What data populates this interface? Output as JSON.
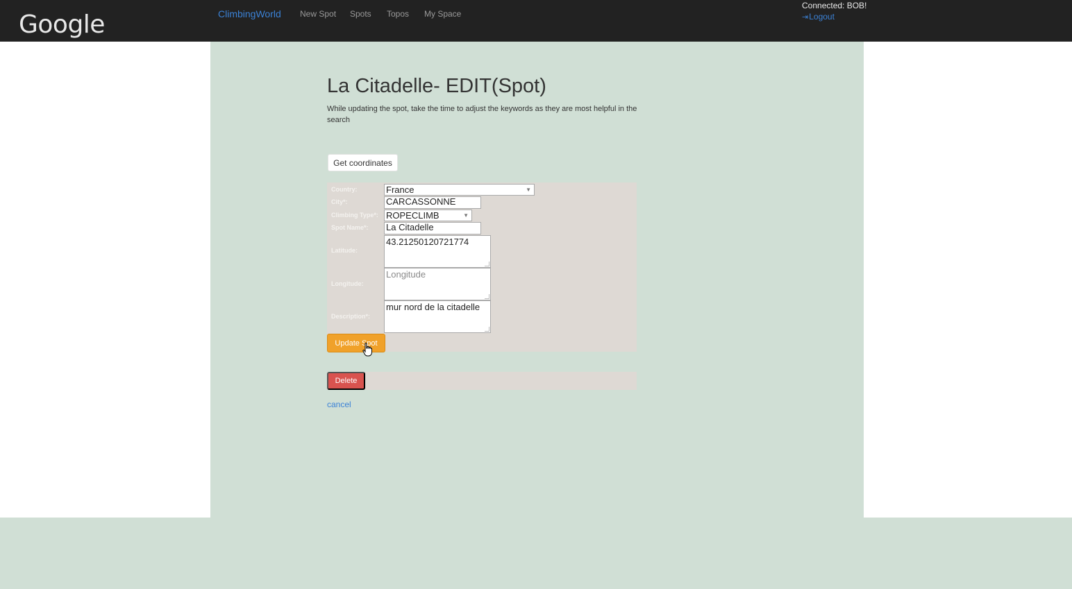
{
  "topbar": {
    "logo_text": "Google",
    "brand": "ClimbingWorld",
    "nav": [
      "New Spot",
      "Spots",
      "Topos",
      "My Space"
    ],
    "connected_text": "Connected: BOB!",
    "logout_label": "Logout",
    "logout_icon": "logout-icon"
  },
  "page": {
    "title": "La Citadelle- EDIT(Spot)",
    "description": "While updating the spot, take the time to adjust the keywords as they are most helpful in the search"
  },
  "buttons": {
    "get_coordinates": "Get coordinates",
    "update_spot": "Update Spot",
    "delete": "Delete",
    "cancel": "cancel"
  },
  "form": {
    "labels": {
      "country": "Country:",
      "city": "City*:",
      "climbing_type": "Climbing Type*:",
      "spot_name": "Spot Name*:",
      "latitude": "Latitude:",
      "longitude": "Longitude:",
      "description": "Description*:"
    },
    "values": {
      "country": "France",
      "city": "CARCASSONNE",
      "climbing_type": "ROPECLIMB",
      "spot_name": "La Citadelle",
      "latitude": "43.21250120721774",
      "longitude": "",
      "description": "mur nord de la citadelle"
    },
    "placeholders": {
      "longitude": "Longitude"
    }
  },
  "colors": {
    "topbar": "#222222",
    "page_background": "#d0dfd5",
    "form_panel": "#ded9d4",
    "link": "#3b82d6",
    "update_button": "#f0a12a",
    "delete_button": "#d9534f"
  }
}
